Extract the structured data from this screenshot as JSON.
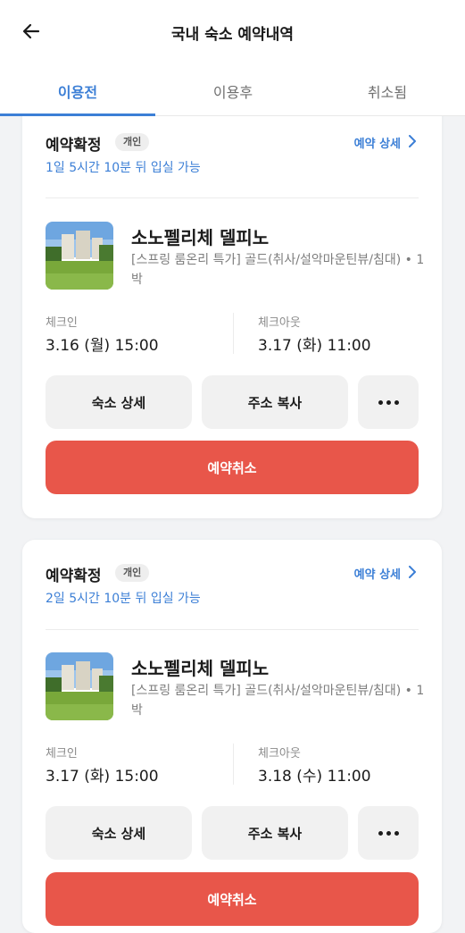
{
  "header": {
    "title": "국내 숙소 예약내역"
  },
  "tabs": [
    {
      "label": "이용전",
      "active": true
    },
    {
      "label": "이용후",
      "active": false
    },
    {
      "label": "취소됨",
      "active": false
    }
  ],
  "reservations": [
    {
      "status": "예약확정",
      "badge": "개인",
      "detail_link": "예약 상세",
      "checkin_note": "1일 5시간 10분 뒤 입실 가능",
      "hotel_name": "소노펠리체 델피노",
      "room_desc": "[스프링 룸온리 특가] 골드(취사/설악마운틴뷰/침대) • 1박",
      "checkin_label": "체크인",
      "checkin_value": "3.16 (월) 15:00",
      "checkout_label": "체크아웃",
      "checkout_value": "3.17 (화) 11:00",
      "btn_detail": "숙소 상세",
      "btn_copy": "주소 복사",
      "btn_cancel": "예약취소"
    },
    {
      "status": "예약확정",
      "badge": "개인",
      "detail_link": "예약 상세",
      "checkin_note": "2일 5시간 10분 뒤 입실 가능",
      "hotel_name": "소노펠리체 델피노",
      "room_desc": "[스프링 룸온리 특가] 골드(취사/설악마운틴뷰/침대) • 1박",
      "checkin_label": "체크인",
      "checkin_value": "3.17 (화) 15:00",
      "checkout_label": "체크아웃",
      "checkout_value": "3.18 (수) 11:00",
      "btn_detail": "숙소 상세",
      "btn_copy": "주소 복사",
      "btn_cancel": "예약취소"
    }
  ],
  "colors": {
    "accent": "#3c7fd6",
    "cancel": "#e8564a"
  }
}
